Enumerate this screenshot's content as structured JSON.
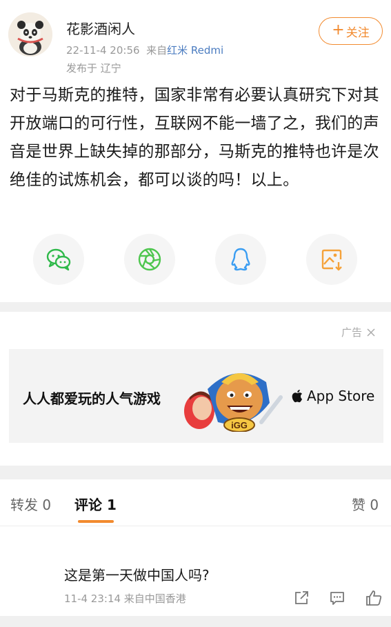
{
  "author": {
    "name": "花影酒闲人",
    "timestamp": "22-11-4 20:56",
    "source_prefix": "来自",
    "source_device": "红米 Redmi",
    "location": "发布于 辽宁"
  },
  "follow": {
    "label": "关注",
    "plus": "+"
  },
  "post": {
    "text": "对于马斯克的推特，国家非常有必要认真研究下对其开放端口的可行性，互联网不能一墙了之，我们的声音是世界上缺失掉的那部分，马斯克的推特也许是次绝佳的试炼机会，都可以谈的吗！以上。"
  },
  "share": [
    {
      "icon": "wechat-icon",
      "color": "#2fb94a"
    },
    {
      "icon": "moments-icon",
      "color": "#4ec64e"
    },
    {
      "icon": "qq-icon",
      "color": "#3a9df2"
    },
    {
      "icon": "save-image-icon",
      "color": "#f5a23a"
    }
  ],
  "ad": {
    "label": "广告",
    "slogan": "人人都爱玩的人气游戏",
    "store": "App Store",
    "game_logo": "iGG"
  },
  "tabs": {
    "repost": "转发 0",
    "comment": "评论 1",
    "like": "赞 0"
  },
  "comment": {
    "text": "这是第一天做中国人吗?",
    "meta": "11-4 23:14  来自中国香港"
  },
  "colors": {
    "accent": "#f28a2e",
    "link": "#4b7cc0"
  }
}
